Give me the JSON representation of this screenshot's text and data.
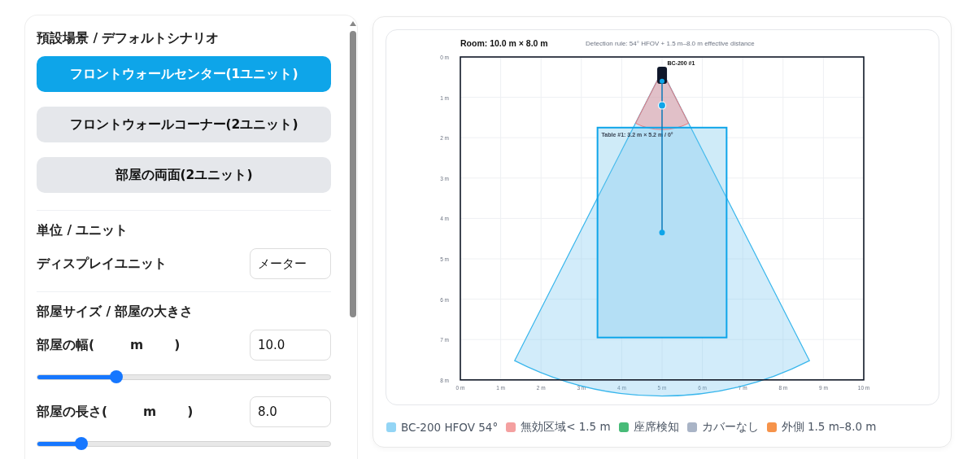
{
  "presets": {
    "title": "預設場景 / デフォルトシナリオ",
    "buttons": [
      {
        "label": "フロントウォールセンター(1ユニット)",
        "selected": true
      },
      {
        "label": "フロントウォールコーナー(2ユニット)",
        "selected": false
      },
      {
        "label": "部屋の両面(2ユニット)",
        "selected": false
      }
    ]
  },
  "units": {
    "title": "単位 / ユニット",
    "label": "ディスプレイユニット",
    "value": "メーター"
  },
  "room_size": {
    "title": "部屋サイズ / 部屋の大きさ",
    "fields": [
      {
        "label": "部屋の幅(",
        "unit": "m",
        "close": ")",
        "value": "10.0",
        "level": 0.27
      },
      {
        "label": "部屋の長さ(",
        "unit": "m",
        "close": ")",
        "value": "8.0",
        "level": 0.15
      }
    ]
  },
  "plan": {
    "title": "Room: 10.0 m × 8.0 m",
    "rule": "Detection rule: 54° HFOV + 1.5 m–8.0 m effective distance",
    "y_ticks": [
      "0 m",
      "1 m",
      "2 m",
      "3 m",
      "4 m",
      "5 m",
      "6 m",
      "7 m",
      "8 m"
    ],
    "x_ticks": [
      "0 m",
      "1 m",
      "2 m",
      "3 m",
      "4 m",
      "5 m",
      "6 m",
      "7 m",
      "8 m",
      "9 m",
      "10 m"
    ],
    "sensor": {
      "label": "BC-200 #1"
    },
    "table": {
      "label": "Table #1: 3.2 m × 5.2 m / 0°"
    }
  },
  "legend": [
    {
      "label": "BC-200 HFOV 54°",
      "color": "#93d5f5"
    },
    {
      "label": "無効区域< 1.5 m",
      "color": "#f4a0a0"
    },
    {
      "label": "座席検知",
      "color": "#48bb78"
    },
    {
      "label": "カバーなし",
      "color": "#a9b4c6"
    },
    {
      "label": "外側 1.5 m–8.0 m",
      "color": "#f6934a"
    }
  ]
}
